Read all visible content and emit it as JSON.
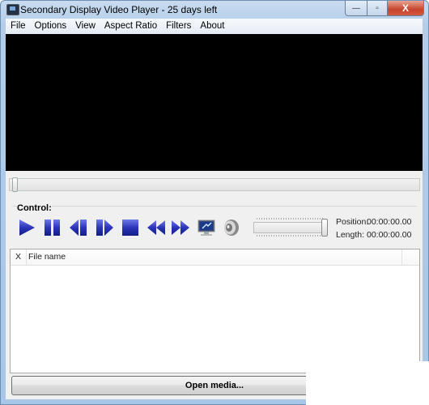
{
  "window": {
    "title": "Secondary Display Video Player - 25 days left"
  },
  "caption_buttons": {
    "minimize": "—",
    "maximize": "▫",
    "close": "X"
  },
  "menu": [
    "File",
    "Options",
    "View",
    "Aspect Ratio",
    "Filters",
    "About"
  ],
  "seek": {
    "position_fraction": 0
  },
  "controls": {
    "label": "Control:",
    "buttons": [
      "play",
      "pause",
      "step-back",
      "step-forward",
      "stop",
      "rewind",
      "fast-forward",
      "secondary-display",
      "volume"
    ],
    "volume_fraction": 1.0,
    "position_label": "Position:",
    "position_value": "00:00:00.00",
    "length_label": "Length:",
    "length_value": "00:00:00.00"
  },
  "playlist": {
    "columns": [
      "X",
      "File name"
    ],
    "rows": []
  },
  "open_button": "Open media..."
}
